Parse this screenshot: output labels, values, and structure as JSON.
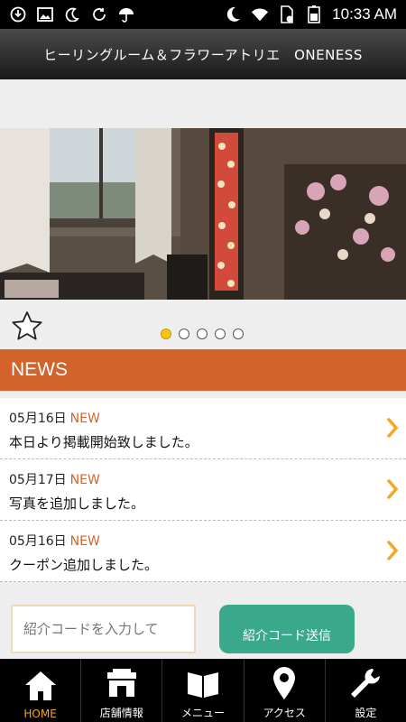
{
  "status_bar": {
    "time": "10:33 AM"
  },
  "app_bar": {
    "title": "ヒーリングルーム＆フラワーアトリエ　ONENESS"
  },
  "slider": {
    "page_count": 5,
    "active_index": 0
  },
  "news": {
    "header": "NEWS",
    "items": [
      {
        "date": "05月16日",
        "badge": "NEW",
        "title": "本日より掲載開始致しました。"
      },
      {
        "date": "05月17日",
        "badge": "NEW",
        "title": "写真を追加しました。"
      },
      {
        "date": "05月16日",
        "badge": "NEW",
        "title": "クーポン追加しました。"
      }
    ]
  },
  "referral": {
    "placeholder": "紹介コードを入力して",
    "button_label": "紹介コード送信"
  },
  "tabs": [
    {
      "label": "HOME",
      "icon": "home-icon",
      "active": true
    },
    {
      "label": "店舗情報",
      "icon": "store-icon",
      "active": false
    },
    {
      "label": "メニュー",
      "icon": "book-icon",
      "active": false
    },
    {
      "label": "アクセス",
      "icon": "location-pin-icon",
      "active": false
    },
    {
      "label": "設定",
      "icon": "wrench-icon",
      "active": false
    }
  ],
  "colors": {
    "accent": "#d2632b",
    "button": "#3aa88a",
    "active_tab": "#f5a623"
  }
}
